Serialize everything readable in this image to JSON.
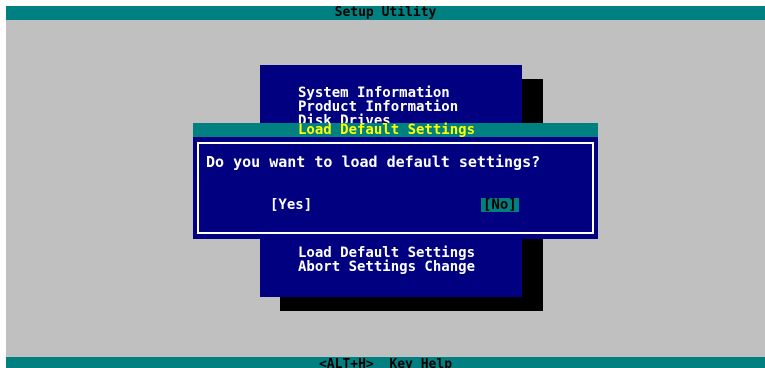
{
  "window": {
    "title": "Setup Utility"
  },
  "menu": {
    "items_top": [
      {
        "label": "System Information"
      },
      {
        "label": "Product Information"
      },
      {
        "label": "Disk Drives"
      }
    ],
    "items_bottom": [
      {
        "label": "Load Default Settings"
      },
      {
        "label": "Abort Settings Change"
      }
    ]
  },
  "dialog": {
    "title": "Load Default Settings",
    "message": "Do you want to load default settings?",
    "yes_label": "[Yes]",
    "no_label": "[No]",
    "selected": "No"
  },
  "statusbar": {
    "key": "<ALT+H>",
    "hint": "Key Help"
  },
  "colors": {
    "background": "#c0c0c0",
    "bar": "#008080",
    "panel": "#000080",
    "highlight_text": "#ffff00",
    "text": "#ffffff"
  }
}
